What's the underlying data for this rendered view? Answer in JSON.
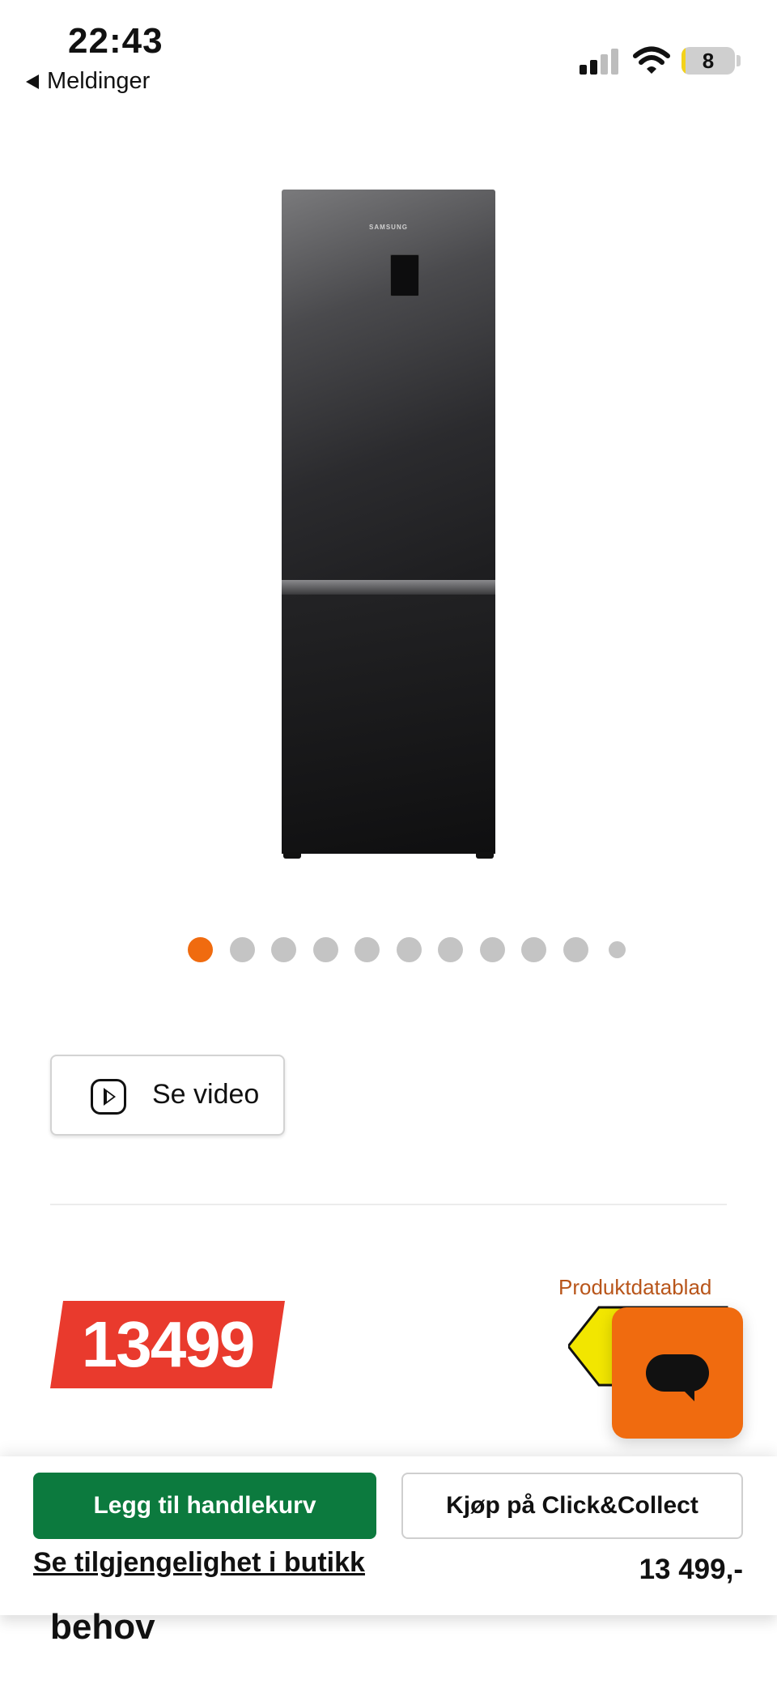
{
  "status_bar": {
    "time": "22:43",
    "back_label": "Meldinger",
    "battery_level": "8",
    "battery_fraction": 0.08
  },
  "product": {
    "brand_mark": "SAMSUNG",
    "carousel": {
      "count": 11,
      "active_index": 0
    },
    "video_button_label": "Se video",
    "datasheet_link": "Produktdatablad",
    "price_badge": "13499"
  },
  "bottom_sheet": {
    "add_to_cart": "Legg til handlekurv",
    "click_collect": "Kjøp på Click&Collect",
    "availability_link": "Se tilgjengelighet i butikk",
    "price": "13 499,-"
  },
  "behind_text": "behov",
  "colors": {
    "accent_orange": "#f06b0f",
    "price_red": "#e93a2d",
    "cart_green": "#0c7a3e",
    "energy_yellow": "#f2e600",
    "link_orange": "#b8551a"
  }
}
